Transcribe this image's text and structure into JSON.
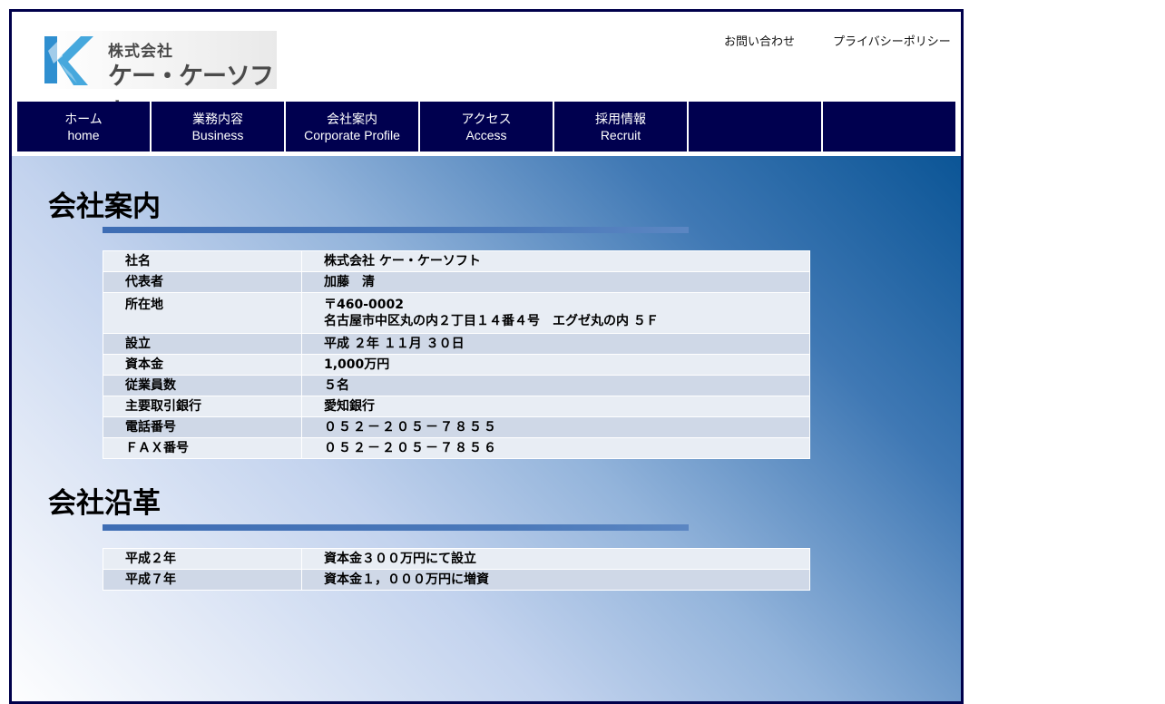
{
  "header": {
    "logo": {
      "company_prefix": "株式会社",
      "company_name": "ケー・ケーソフト",
      "icon": "kk-logo-icon"
    },
    "links": {
      "contact": "お問い合わせ",
      "privacy": "プライバシーポリシー"
    }
  },
  "nav": {
    "items": [
      {
        "ja": "ホーム",
        "en": "home"
      },
      {
        "ja": "業務内容",
        "en": "Business"
      },
      {
        "ja": "会社案内",
        "en": "Corporate Profile"
      },
      {
        "ja": "アクセス",
        "en": "Access"
      },
      {
        "ja": "採用情報",
        "en": "Recruit"
      },
      {
        "ja": "",
        "en": ""
      },
      {
        "ja": "",
        "en": ""
      }
    ]
  },
  "profile": {
    "title": "会社案内",
    "rows": [
      {
        "label": "社名",
        "value": "株式会社 ケー・ケーソフト"
      },
      {
        "label": "代表者",
        "value": "加藤　清"
      },
      {
        "label": "所在地",
        "value": "〒460-0002",
        "value2": "名古屋市中区丸の内２丁目１４番４号　エグゼ丸の内 ５Ｆ"
      },
      {
        "label": "設立",
        "value": "平成 ２年 １１月 ３０日"
      },
      {
        "label": "資本金",
        "value": "1,000万円"
      },
      {
        "label": "従業員数",
        "value": "５名"
      },
      {
        "label": "主要取引銀行",
        "value": "愛知銀行"
      },
      {
        "label": "電話番号",
        "value": "０５２－２０５－７８５５"
      },
      {
        "label": "ＦＡＸ番号",
        "value": "０５２－２０５－７８５６"
      }
    ]
  },
  "history": {
    "title": "会社沿革",
    "rows": [
      {
        "label": "平成２年",
        "value": "資本金３００万円にて設立"
      },
      {
        "label": "平成７年",
        "value": "資本金１，０００万円に増資"
      }
    ]
  },
  "colors": {
    "nav_bg": "#00004f",
    "frame_border": "#00004b",
    "rule": "#4b79ba",
    "row_light": "#e8edf4",
    "row_dark": "#cfd8e7"
  }
}
